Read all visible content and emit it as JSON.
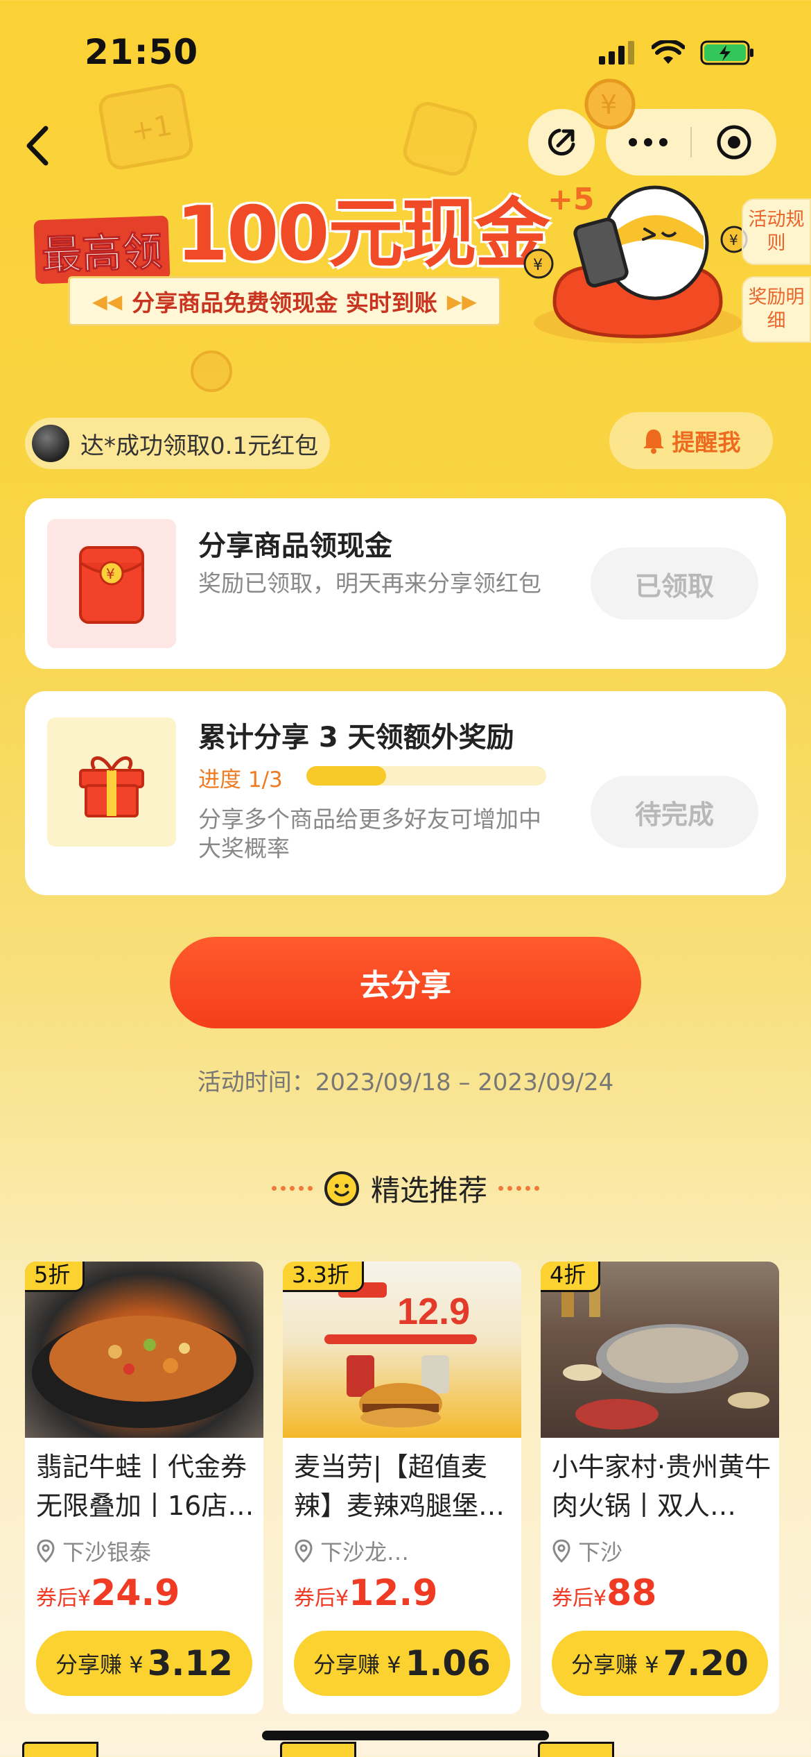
{
  "status_bar": {
    "time": "21:50"
  },
  "hero": {
    "title_small": "最高领",
    "title_big": "100元现金",
    "subtitle": "分享商品免费领现金  实时到账",
    "bonus": "+5"
  },
  "side_tabs": {
    "rules": "活动规则",
    "details": "奖励明细"
  },
  "ticker": {
    "text": "达*成功领取0.1元红包"
  },
  "remind_label": "提醒我",
  "tasks": [
    {
      "title": "分享商品领现金",
      "desc": "奖励已领取，明天再来分享领红包",
      "button": "已领取"
    },
    {
      "title": "累计分享 3 天领额外奖励",
      "progress_label": "进度 1/3",
      "progress": 0.333,
      "desc": "分享多个商品给更多好友可增加中大奖概率",
      "button": "待完成"
    }
  ],
  "share_button": "去分享",
  "period": "活动时间：2023/09/18 – 2023/09/24",
  "section_title": "精选推荐",
  "products": [
    {
      "badge": "5折",
      "name": "翡記牛蛙丨代金券无限叠加丨16店…",
      "location": "下沙银泰",
      "price_prefix": "券后¥",
      "price": "24.9",
      "earn_label": "分享赚 ¥",
      "earn": "3.12"
    },
    {
      "badge": "3.3折",
      "name": "麦当劳|【超值麦辣】麦辣鸡腿堡…",
      "location": "下沙龙…",
      "price_prefix": "券后¥",
      "price": "12.9",
      "earn_label": "分享赚 ¥",
      "earn": "1.06",
      "img_price": "12.9"
    },
    {
      "badge": "4折",
      "name": "小牛家村·贵州黄牛肉火锅丨双人…",
      "location": "下沙",
      "price_prefix": "券后¥",
      "price": "88",
      "earn_label": "分享赚 ¥",
      "earn": "7.20"
    }
  ],
  "colors": {
    "accent": "#f43e1c",
    "yellow": "#fbd22f",
    "price_red": "#ef3b24"
  }
}
